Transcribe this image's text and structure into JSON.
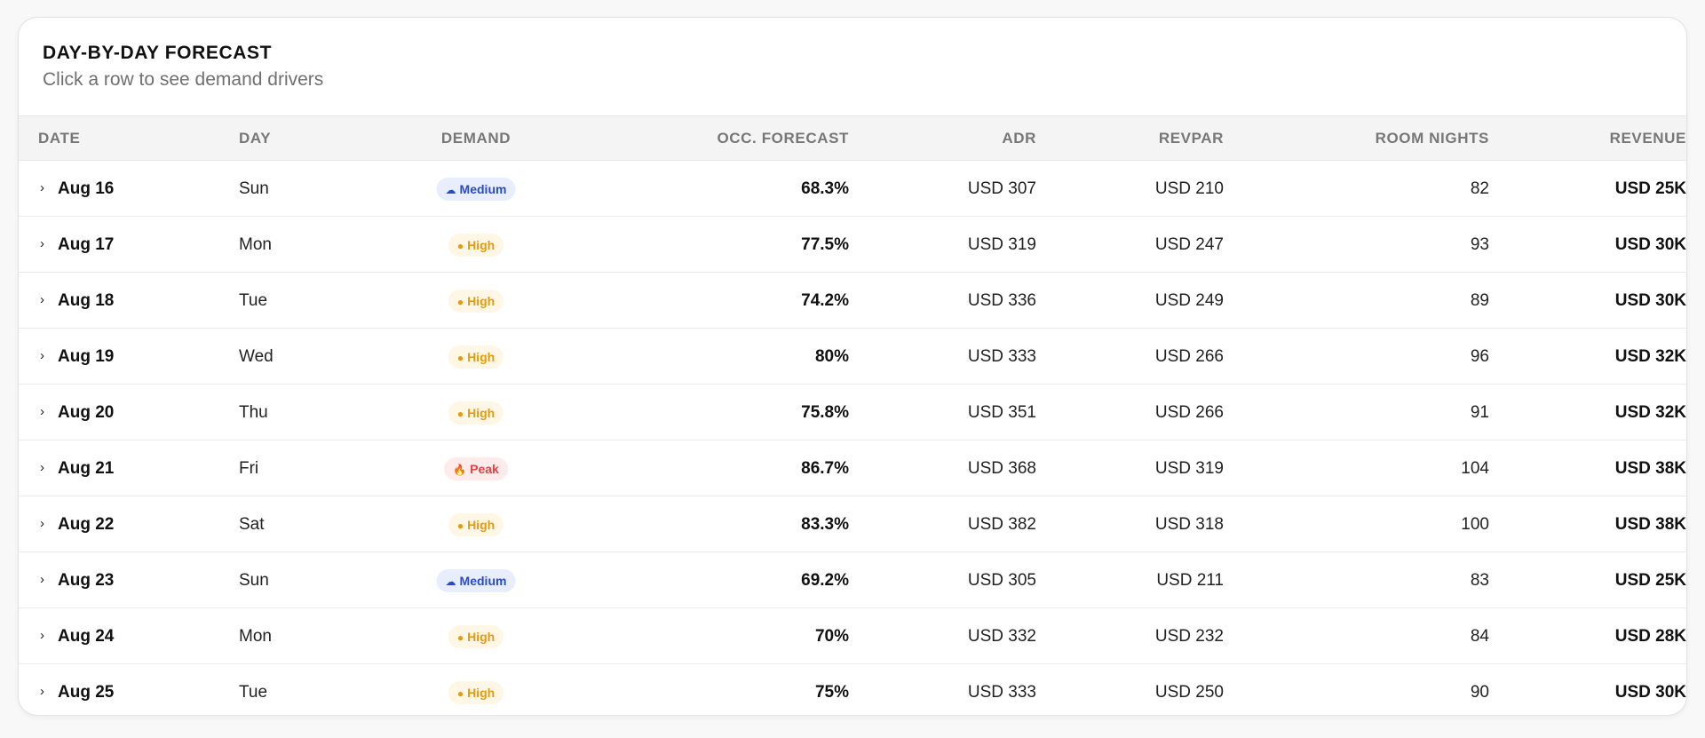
{
  "header": {
    "title": "DAY-BY-DAY FORECAST",
    "subtitle": "Click a row to see demand drivers"
  },
  "columns": {
    "date": "DATE",
    "day": "DAY",
    "demand": "DEMAND",
    "occ": "OCC. FORECAST",
    "adr": "ADR",
    "revpar": "REVPAR",
    "room_nights": "ROOM NIGHTS",
    "revenue": "REVENUE"
  },
  "icons": {
    "expand": "chevron-right-icon",
    "Medium": "cloud-icon",
    "High": "sun-icon",
    "Peak": "fire-icon"
  },
  "colors": {
    "medium_bg": "#e9eeff",
    "medium_fg": "#2a4bc8",
    "high_bg": "#fff7e6",
    "high_fg": "#e69a10",
    "peak_bg": "#fdeceb",
    "peak_fg": "#e04444"
  },
  "rows": [
    {
      "date": "Aug 16",
      "day": "Sun",
      "demand": "Medium",
      "occ": "68.3%",
      "adr": "USD 307",
      "revpar": "USD 210",
      "room_nights": "82",
      "revenue": "USD 25K"
    },
    {
      "date": "Aug 17",
      "day": "Mon",
      "demand": "High",
      "occ": "77.5%",
      "adr": "USD 319",
      "revpar": "USD 247",
      "room_nights": "93",
      "revenue": "USD 30K"
    },
    {
      "date": "Aug 18",
      "day": "Tue",
      "demand": "High",
      "occ": "74.2%",
      "adr": "USD 336",
      "revpar": "USD 249",
      "room_nights": "89",
      "revenue": "USD 30K"
    },
    {
      "date": "Aug 19",
      "day": "Wed",
      "demand": "High",
      "occ": "80%",
      "adr": "USD 333",
      "revpar": "USD 266",
      "room_nights": "96",
      "revenue": "USD 32K"
    },
    {
      "date": "Aug 20",
      "day": "Thu",
      "demand": "High",
      "occ": "75.8%",
      "adr": "USD 351",
      "revpar": "USD 266",
      "room_nights": "91",
      "revenue": "USD 32K"
    },
    {
      "date": "Aug 21",
      "day": "Fri",
      "demand": "Peak",
      "occ": "86.7%",
      "adr": "USD 368",
      "revpar": "USD 319",
      "room_nights": "104",
      "revenue": "USD 38K"
    },
    {
      "date": "Aug 22",
      "day": "Sat",
      "demand": "High",
      "occ": "83.3%",
      "adr": "USD 382",
      "revpar": "USD 318",
      "room_nights": "100",
      "revenue": "USD 38K"
    },
    {
      "date": "Aug 23",
      "day": "Sun",
      "demand": "Medium",
      "occ": "69.2%",
      "adr": "USD 305",
      "revpar": "USD 211",
      "room_nights": "83",
      "revenue": "USD 25K"
    },
    {
      "date": "Aug 24",
      "day": "Mon",
      "demand": "High",
      "occ": "70%",
      "adr": "USD 332",
      "revpar": "USD 232",
      "room_nights": "84",
      "revenue": "USD 28K"
    },
    {
      "date": "Aug 25",
      "day": "Tue",
      "demand": "High",
      "occ": "75%",
      "adr": "USD 333",
      "revpar": "USD 250",
      "room_nights": "90",
      "revenue": "USD 30K"
    }
  ]
}
